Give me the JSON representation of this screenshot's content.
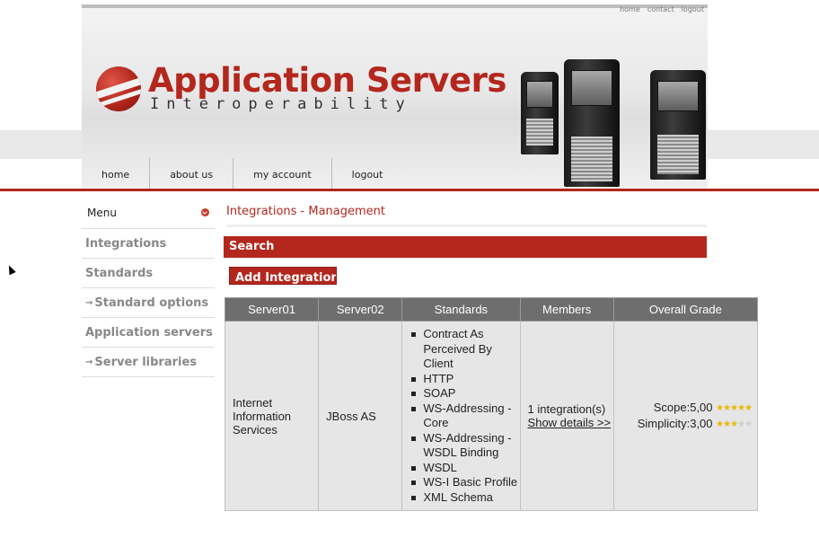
{
  "top_links": [
    "home",
    "contact",
    "logout"
  ],
  "logo": {
    "title": "Application Servers",
    "subtitle": "Interoperability"
  },
  "nav": [
    "home",
    "about us",
    "my account",
    "logout"
  ],
  "menu": {
    "header": "Menu",
    "items": [
      {
        "label": "Integrations",
        "sub": false
      },
      {
        "label": "Standards",
        "sub": false
      },
      {
        "label": "Standard options",
        "sub": true
      },
      {
        "label": "Application servers",
        "sub": false
      },
      {
        "label": "Server libraries",
        "sub": true
      }
    ]
  },
  "main": {
    "title": "Integrations - Management",
    "search_label": "Search",
    "add_button": "Add Integration"
  },
  "table": {
    "headers": [
      "Server01",
      "Server02",
      "Standards",
      "Members",
      "Overall Grade"
    ],
    "rows": [
      {
        "server01": "Internet Information Services",
        "server02": "JBoss AS",
        "standards": [
          "Contract As Perceived By Client",
          "HTTP",
          "SOAP",
          "WS-Addressing - Core",
          "WS-Addressing - WSDL Binding",
          "WSDL",
          "WS-I Basic Profile",
          "XML Schema"
        ],
        "members_count": "1 integration(s)",
        "members_link": "Show details >>",
        "grades": [
          {
            "label": "Scope:",
            "value": "5,00",
            "stars": 5
          },
          {
            "label": "Simplicity:",
            "value": "3,00",
            "stars": 3
          }
        ]
      }
    ]
  },
  "colors": {
    "accent": "#b3271d",
    "table_header": "#6e6e6e",
    "cell_bg": "#e6e6e6"
  }
}
